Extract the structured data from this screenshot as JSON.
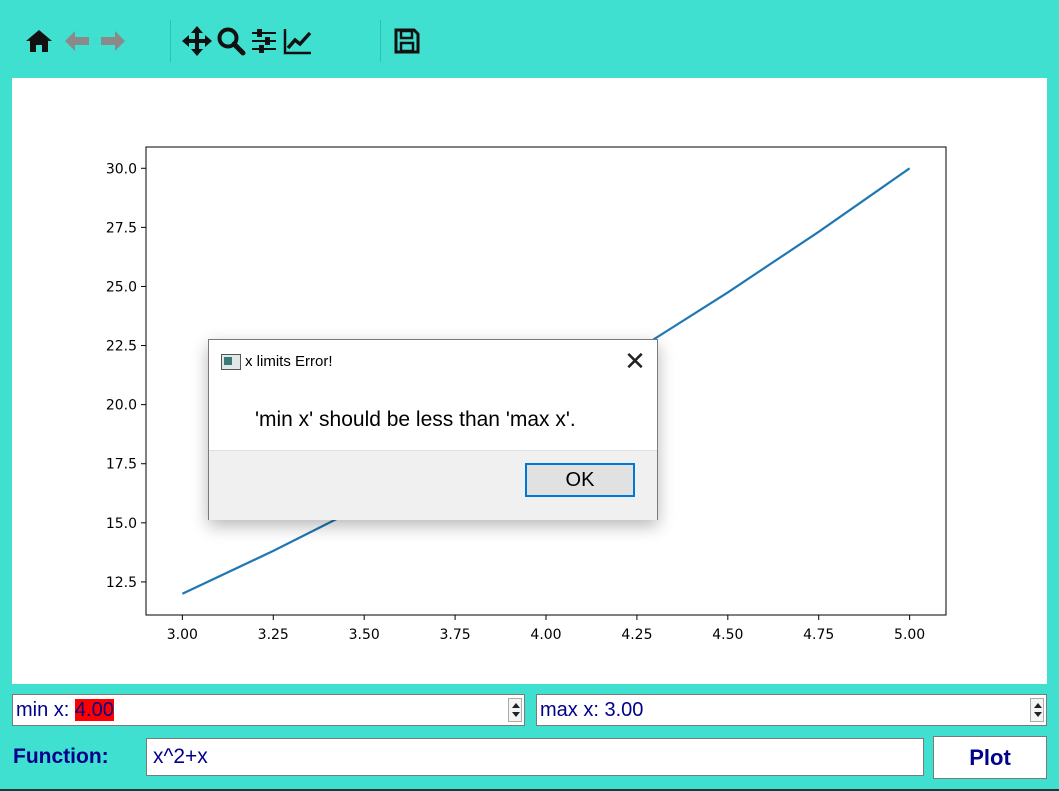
{
  "toolbar": {
    "buttons": [
      {
        "icon": "home-icon"
      },
      {
        "icon": "back-arrow-icon"
      },
      {
        "icon": "forward-arrow-icon"
      },
      {
        "icon": "pan-icon"
      },
      {
        "icon": "zoom-icon"
      },
      {
        "icon": "configure-subplots-icon"
      },
      {
        "icon": "edit-axis-icon"
      },
      {
        "icon": "save-icon"
      }
    ],
    "colors": {
      "icon": "#111111",
      "icon_disabled": "#8a8a8a",
      "background": "#40e0d0"
    }
  },
  "chart_data": {
    "type": "line",
    "x": [
      3.0,
      3.25,
      3.5,
      3.75,
      4.0,
      4.25,
      4.5,
      4.75,
      5.0
    ],
    "y": [
      12.0,
      13.8125,
      15.75,
      17.8125,
      20.0,
      22.3125,
      24.75,
      27.3125,
      30.0
    ],
    "xlim": [
      2.9,
      5.1
    ],
    "ylim": [
      11.1,
      30.9
    ],
    "xticks": [
      "3.00",
      "3.25",
      "3.50",
      "3.75",
      "4.00",
      "4.25",
      "4.50",
      "4.75",
      "5.00"
    ],
    "yticks": [
      "12.5",
      "15.0",
      "17.5",
      "20.0",
      "22.5",
      "25.0",
      "27.5",
      "30.0"
    ],
    "line_color": "#1f77b4",
    "grid": false
  },
  "dialog": {
    "title": "x limits Error!",
    "message": "'min x' should be less than 'max x'.",
    "ok_label": "OK",
    "close_glyph": "✕"
  },
  "controls": {
    "min_x": {
      "label": "min x: ",
      "value": "4.00",
      "error_color": "#ff0000"
    },
    "max_x": {
      "label": "max x: ",
      "value": "3.00"
    },
    "function_label": "Function:",
    "function_value": "x^2+x",
    "plot_label": "Plot",
    "text_color": "#00008b"
  }
}
